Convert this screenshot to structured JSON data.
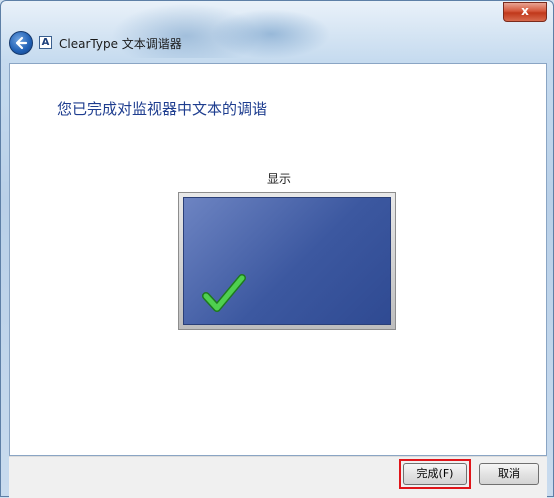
{
  "window": {
    "title": "ClearType 文本调谐器",
    "app_icon_letter": "A",
    "close_label": "x",
    "back_icon": "back-arrow-icon"
  },
  "main": {
    "heading": "您已完成对监视器中文本的调谐",
    "monitor_label": "显示",
    "monitor_icon": "checkmark-icon"
  },
  "footer": {
    "finish_label": "完成(F)",
    "cancel_label": "取消"
  },
  "colors": {
    "heading": "#1e3d8f",
    "screen": "#3c58a0",
    "checkmark": "#3fbf3f",
    "highlight": "#e0151a"
  }
}
